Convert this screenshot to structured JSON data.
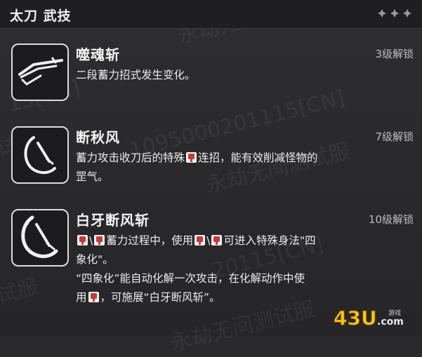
{
  "header": {
    "title": "太刀 武技"
  },
  "skills": [
    {
      "name": "噬魂斩",
      "unlock": "3级解锁",
      "lines": [
        "二段蓄力招式发生变化。"
      ]
    },
    {
      "name": "断秋风",
      "unlock": "7级解锁",
      "line1_a": "蓄力攻击收刀后的特殊",
      "line1_b": "连招，能有效削减怪物的",
      "line2": "罡气。"
    },
    {
      "name": "白牙断风斩",
      "unlock": "10级解锁",
      "line1_sep": "\\",
      "line1_a": "蓄力过程中，使用",
      "line1_sep2": "\\",
      "line1_b": "可进入特殊身法\"四",
      "line2": "象化\"。",
      "line3": "“四象化”能自动化解一次攻击，在化解动作中使",
      "line4_a": "用",
      "line4_b": "，可施展“白牙断风斩”。"
    }
  ],
  "watermark": {
    "text1": "永劫无间测试服",
    "text2": "1095000201115[CN]",
    "text3": "15[CN]",
    "text4": "试服",
    "text5": "永劫无间测试服",
    "text6": "20115[CN]"
  },
  "logo": {
    "text": "43U",
    "suffix": ".com",
    "sub": "游戏"
  },
  "colors": {
    "accent_button": "#c23a3a",
    "text_main": "#ececec",
    "text_muted": "#bdbdbd",
    "border_icon": "#dcdcdc"
  }
}
